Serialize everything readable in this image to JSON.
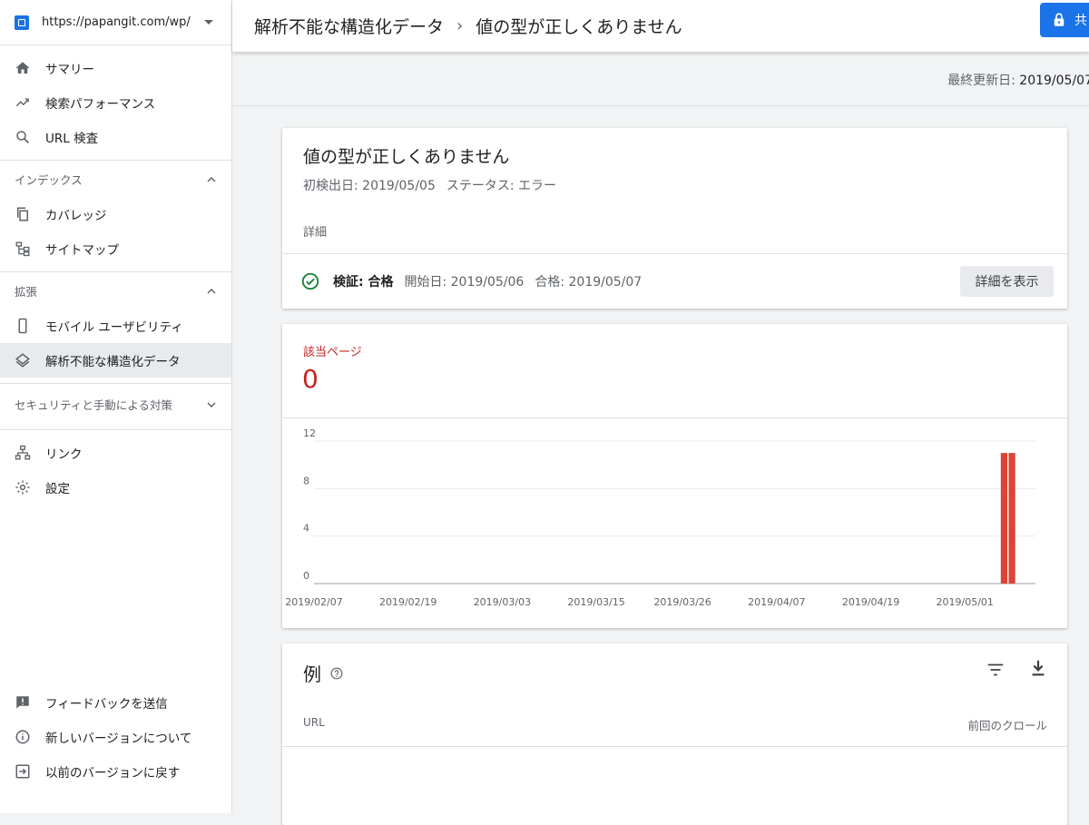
{
  "property": {
    "url": "https://papangit.com/wp/"
  },
  "nav_top": [
    {
      "label": "サマリー",
      "icon": "home-icon"
    },
    {
      "label": "検索パフォーマンス",
      "icon": "trending-icon"
    },
    {
      "label": "URL 検査",
      "icon": "search-icon"
    }
  ],
  "index_section": {
    "title": "インデックス",
    "items": [
      {
        "label": "カバレッジ",
        "icon": "copy-icon"
      },
      {
        "label": "サイトマップ",
        "icon": "sitemap-icon"
      }
    ]
  },
  "enhance_section": {
    "title": "拡張",
    "items": [
      {
        "label": "モバイル ユーザビリティ",
        "icon": "phone-icon"
      },
      {
        "label": "解析不能な構造化データ",
        "icon": "layers-icon"
      }
    ]
  },
  "security_section": {
    "title": "セキュリティと手動による対策"
  },
  "nav_other": [
    {
      "label": "リンク",
      "icon": "links-icon"
    },
    {
      "label": "設定",
      "icon": "gear-icon"
    }
  ],
  "nav_bottom": [
    {
      "label": "フィードバックを送信",
      "icon": "feedback-icon"
    },
    {
      "label": "新しいバージョンについて",
      "icon": "info-icon"
    },
    {
      "label": "以前のバージョンに戻す",
      "icon": "exit-icon"
    }
  ],
  "header": {
    "crumb_parent": "解析不能な構造化データ",
    "crumb_current": "値の型が正しくありません",
    "share_label": "共"
  },
  "last_updated": {
    "label": "最終更新日:",
    "date": "2019/05/07"
  },
  "issue_card": {
    "title": "値の型が正しくありません",
    "first_detected": "初検出日: 2019/05/05",
    "status": "ステータス: エラー",
    "details_label": "詳細",
    "validation_label": "検証: 合格",
    "validation_start": "開始日: 2019/05/06",
    "validation_passed": "合格: 2019/05/07",
    "detail_button": "詳細を表示",
    "check_color": "#188038"
  },
  "affected_card": {
    "label": "該当ページ",
    "count": "0",
    "accent": "#c5221f"
  },
  "chart_data": {
    "type": "bar",
    "title": "",
    "xlabel": "",
    "ylabel": "",
    "ylim": [
      0,
      12
    ],
    "yticks": [
      0,
      4,
      8,
      12
    ],
    "x_tick_labels": [
      "2019/02/07",
      "2019/02/19",
      "2019/03/03",
      "2019/03/15",
      "2019/03/26",
      "2019/04/07",
      "2019/04/19",
      "2019/05/01"
    ],
    "x_start": "2019/02/07",
    "x_end": "2019/05/10",
    "series": [
      {
        "color": "#db4437",
        "points": [
          {
            "x": "2019/05/06",
            "y": 11
          },
          {
            "x": "2019/05/07",
            "y": 11
          }
        ]
      }
    ],
    "grid": true
  },
  "examples_card": {
    "title": "例",
    "col_url": "URL",
    "col_crawl": "前回のクロール"
  }
}
